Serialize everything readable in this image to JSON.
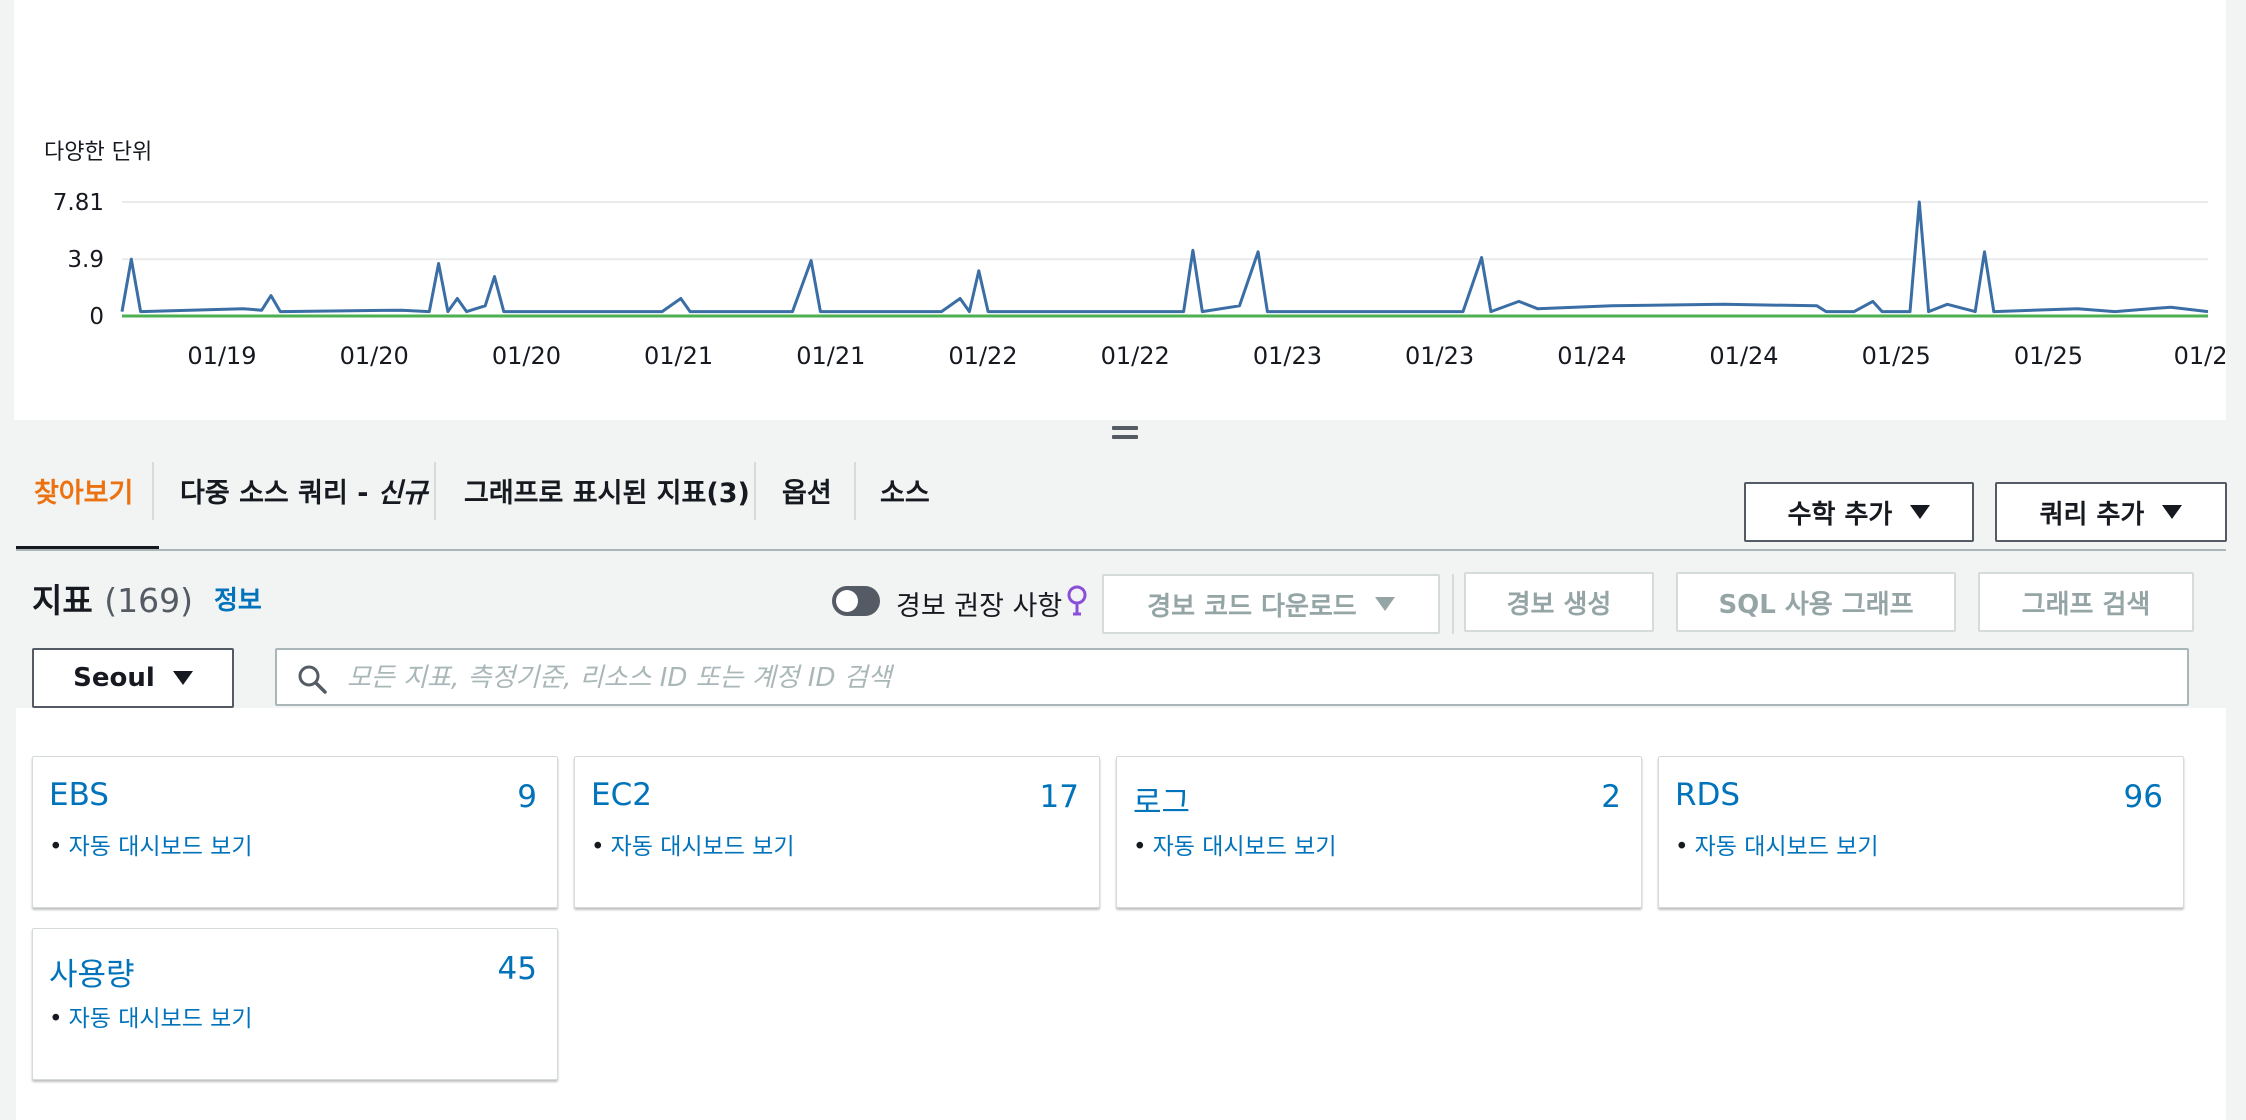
{
  "chart": {
    "unit_label": "다양한 단위"
  },
  "chart_data": {
    "type": "line",
    "ylabel": "다양한 단위",
    "yticks": [
      "0",
      "3.9",
      "7.81"
    ],
    "ylim": [
      0,
      7.81
    ],
    "xticks": [
      "01/19",
      "01/20",
      "01/20",
      "01/21",
      "01/21",
      "01/22",
      "01/22",
      "01/23",
      "01/23",
      "01/24",
      "01/24",
      "01/25",
      "01/25",
      "01/2"
    ],
    "grid": true,
    "series": [
      {
        "color": "#3a6ea5",
        "points": [
          [
            0,
            0.3
          ],
          [
            0.5,
            3.9
          ],
          [
            1,
            0.3
          ],
          [
            6.5,
            0.5
          ],
          [
            7.5,
            0.4
          ],
          [
            8,
            1.4
          ],
          [
            8.5,
            0.3
          ],
          [
            15,
            0.4
          ],
          [
            16.5,
            0.3
          ],
          [
            17,
            3.6
          ],
          [
            17.5,
            0.3
          ],
          [
            18,
            1.2
          ],
          [
            18.5,
            0.3
          ],
          [
            19.5,
            0.7
          ],
          [
            20,
            2.7
          ],
          [
            20.5,
            0.3
          ],
          [
            29,
            0.3
          ],
          [
            30,
            1.2
          ],
          [
            30.5,
            0.3
          ],
          [
            36,
            0.3
          ],
          [
            37,
            3.8
          ],
          [
            37.5,
            0.3
          ],
          [
            44,
            0.3
          ],
          [
            45,
            1.2
          ],
          [
            45.5,
            0.3
          ],
          [
            46,
            3.1
          ],
          [
            46.5,
            0.3
          ],
          [
            57,
            0.3
          ],
          [
            57.5,
            4.5
          ],
          [
            58,
            0.3
          ],
          [
            60,
            0.7
          ],
          [
            61,
            4.4
          ],
          [
            61.5,
            0.3
          ],
          [
            72,
            0.3
          ],
          [
            73,
            4.0
          ],
          [
            73.5,
            0.3
          ],
          [
            75,
            1.0
          ],
          [
            76,
            0.5
          ],
          [
            80,
            0.7
          ],
          [
            86,
            0.8
          ],
          [
            91,
            0.7
          ],
          [
            91.5,
            0.3
          ],
          [
            93,
            0.3
          ],
          [
            94,
            1.0
          ],
          [
            94.5,
            0.3
          ],
          [
            96,
            0.3
          ],
          [
            96.5,
            7.81
          ],
          [
            97,
            0.3
          ],
          [
            98,
            0.8
          ],
          [
            99.5,
            0.3
          ],
          [
            100,
            4.4
          ],
          [
            100.5,
            0.3
          ],
          [
            105,
            0.5
          ],
          [
            107,
            0.3
          ],
          [
            110,
            0.6
          ],
          [
            112,
            0.3
          ]
        ]
      },
      {
        "color": "#4caf50",
        "points": [
          [
            0,
            0.0
          ],
          [
            112,
            0.0
          ]
        ]
      }
    ]
  },
  "tabs": [
    {
      "label": "찾아보기"
    },
    {
      "label": "다중 소스 쿼리 - ",
      "tag": "신규"
    },
    {
      "label": "그래프로 표시된 지표(3)"
    },
    {
      "label": "옵션"
    },
    {
      "label": "소스"
    }
  ],
  "toolbar": {
    "math_label": "수학 추가",
    "query_label": "쿼리 추가"
  },
  "metrics": {
    "title": "지표",
    "count": "(169)",
    "info": "정보",
    "alarm_toggle_label": "경보 권장 사항",
    "download_alarm_code": "경보 코드 다운로드",
    "create_alarm": "경보 생성",
    "sql_graph": "SQL 사용 그래프",
    "graph_search": "그래프 검색",
    "region": "Seoul",
    "search_placeholder": "모든 지표, 측정기준, 리소스 ID 또는 계정 ID 검색"
  },
  "cards": [
    {
      "name": "EBS",
      "count": "9",
      "link": "자동 대시보드 보기"
    },
    {
      "name": "EC2",
      "count": "17",
      "link": "자동 대시보드 보기"
    },
    {
      "name": "로그",
      "count": "2",
      "link": "자동 대시보드 보기"
    },
    {
      "name": "RDS",
      "count": "96",
      "link": "자동 대시보드 보기"
    },
    {
      "name": "사용량",
      "count": "45",
      "link": "자동 대시보드 보기"
    }
  ]
}
